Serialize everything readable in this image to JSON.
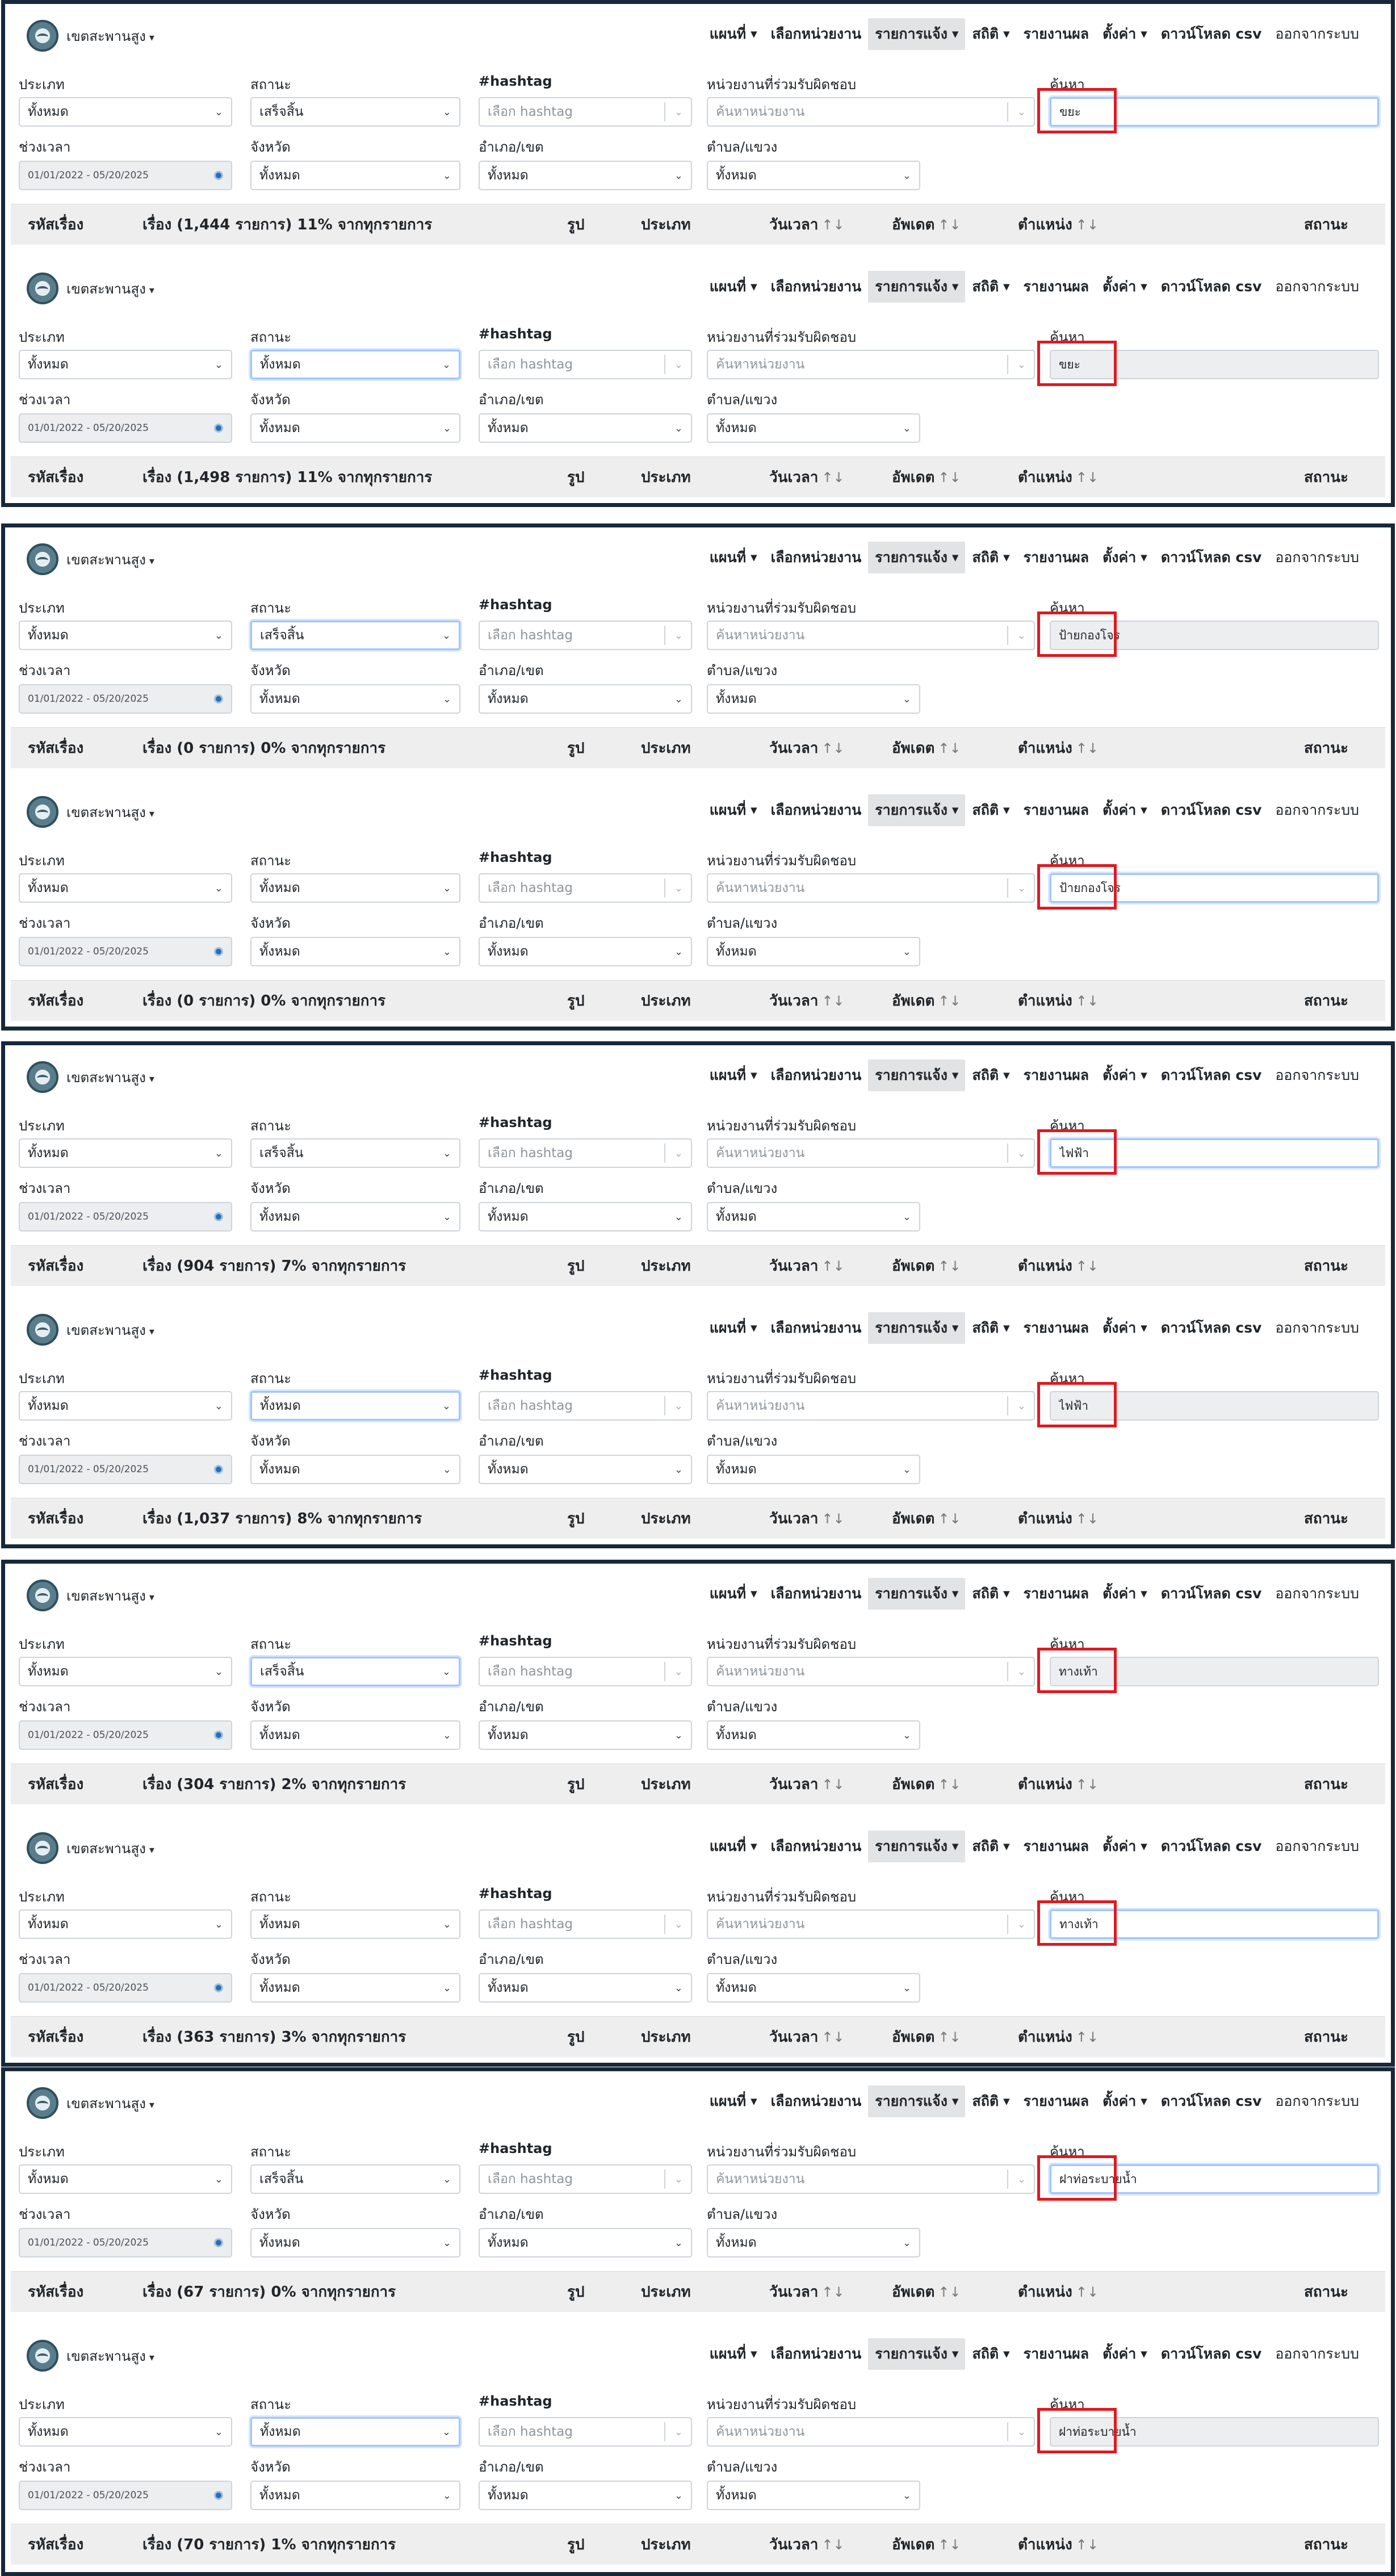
{
  "nav": {
    "brand": "เขตสะพานสูง",
    "items": [
      "แผนที่",
      "เลือกหน่วยงาน",
      "รายการแจ้ง",
      "สถิติ",
      "รายงานผล",
      "ตั้งค่า",
      "ดาวน์โหลด csv",
      "ออกจากระบบ"
    ]
  },
  "labels": {
    "type": "ประเภท",
    "status": "สถานะ",
    "hashtag": "#hashtag",
    "agency": "หน่วยงานที่ร่วมรับผิดชอบ",
    "search": "ค้นหา",
    "date_range": "ช่วงเวลา",
    "province": "จังหวัด",
    "district": "อำเภอ/เขต",
    "subdistrict": "ตำบล/แขวง"
  },
  "values": {
    "type": "ทั้งหมด",
    "hashtag_placeholder": "เลือก hashtag",
    "agency_placeholder": "ค้นหาหน่วยงาน",
    "date_range": "01/01/2022 - 05/20/2025",
    "province": "ทั้งหมด",
    "district": "ทั้งหมด",
    "subdistrict": "ทั้งหมด"
  },
  "table_headers": {
    "id": "รหัสเรื่อง",
    "photo": "รูป",
    "type": "ประเภท",
    "datetime": "วันเวลา",
    "updated": "อัพเดต",
    "location": "ตำแหน่ง",
    "status": "สถานะ",
    "sort_icon": "↑↓"
  },
  "panels": [
    {
      "status": "เสร็จสิ้น",
      "search": "ขยะ",
      "summary": "เรื่อง (1,444 รายการ) 11% จากทุกรายการ"
    },
    {
      "status": "ทั้งหมด",
      "search": "ขยะ",
      "summary": "เรื่อง (1,498 รายการ) 11% จากทุกรายการ"
    },
    {
      "status": "เสร็จสิ้น",
      "search": "ป้ายกองโจร",
      "summary": "เรื่อง (0 รายการ) 0% จากทุกรายการ"
    },
    {
      "status": "ทั้งหมด",
      "search": "ป้ายกองโจร",
      "summary": "เรื่อง (0 รายการ) 0% จากทุกรายการ"
    },
    {
      "status": "เสร็จสิ้น",
      "search": "ไฟฟ้า",
      "summary": "เรื่อง (904 รายการ) 7% จากทุกรายการ"
    },
    {
      "status": "ทั้งหมด",
      "search": "ไฟฟ้า",
      "summary": "เรื่อง (1,037 รายการ) 8% จากทุกรายการ"
    },
    {
      "status": "เสร็จสิ้น",
      "search": "ทางเท้า",
      "summary": "เรื่อง (304 รายการ) 2% จากทุกรายการ"
    },
    {
      "status": "ทั้งหมด",
      "search": "ทางเท้า",
      "summary": "เรื่อง (363 รายการ) 3% จากทุกรายการ"
    },
    {
      "status": "เสร็จสิ้น",
      "search": "ฝาท่อระบายน้ำ",
      "summary": "เรื่อง (67 รายการ) 0% จากทุกรายการ"
    },
    {
      "status": "ทั้งหมด",
      "search": "ฝาท่อระบายน้ำ",
      "summary": "เรื่อง (70 รายการ) 1% จากทุกรายการ"
    }
  ]
}
